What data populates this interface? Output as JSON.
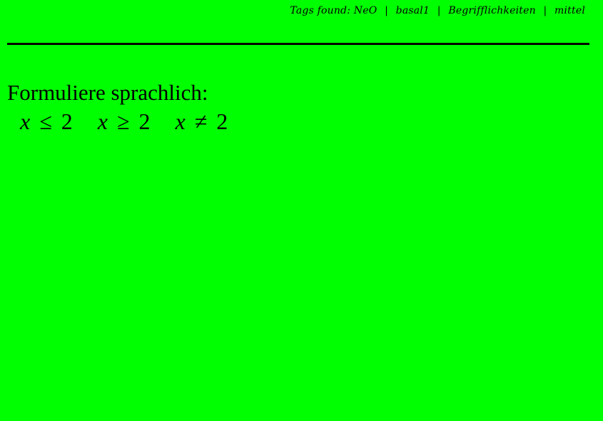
{
  "header": {
    "tags_label": "Tags found:",
    "tags": [
      "NeO",
      "basal1",
      "Begrifflichkeiten",
      "mittel"
    ],
    "separator": "|"
  },
  "content": {
    "prompt": "Formuliere sprachlich:",
    "expressions": [
      {
        "variable": "x",
        "operator": "≤",
        "value": "2"
      },
      {
        "variable": "x",
        "operator": "≥",
        "value": "2"
      },
      {
        "variable": "x",
        "operator": "≠",
        "value": "2"
      }
    ]
  },
  "colors": {
    "background": "#00ff00",
    "text": "#000000",
    "rule": "#000000"
  }
}
